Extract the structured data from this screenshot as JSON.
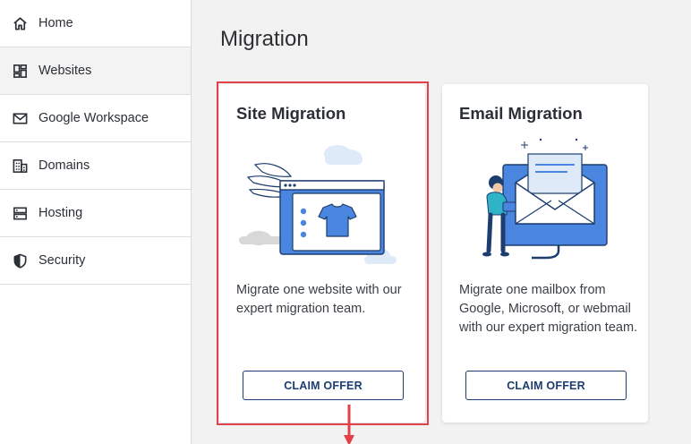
{
  "sidebar": {
    "items": [
      {
        "label": "Home",
        "icon": "home-icon"
      },
      {
        "label": "Websites",
        "icon": "websites-icon"
      },
      {
        "label": "Google Workspace",
        "icon": "mail-icon"
      },
      {
        "label": "Domains",
        "icon": "domains-icon"
      },
      {
        "label": "Hosting",
        "icon": "server-icon"
      },
      {
        "label": "Security",
        "icon": "shield-icon"
      }
    ]
  },
  "main": {
    "title": "Migration",
    "cards": [
      {
        "title": "Site Migration",
        "description": "Migrate one website with our expert migration team.",
        "button_label": "CLAIM OFFER"
      },
      {
        "title": "Email Migration",
        "description": "Migrate one mailbox from Google, Microsoft, or webmail with our expert migration team.",
        "button_label": "CLAIM OFFER"
      }
    ]
  },
  "colors": {
    "highlight": "#e0414b",
    "button_border": "#1c3d6e",
    "illustration_blue": "#4a86e0"
  }
}
